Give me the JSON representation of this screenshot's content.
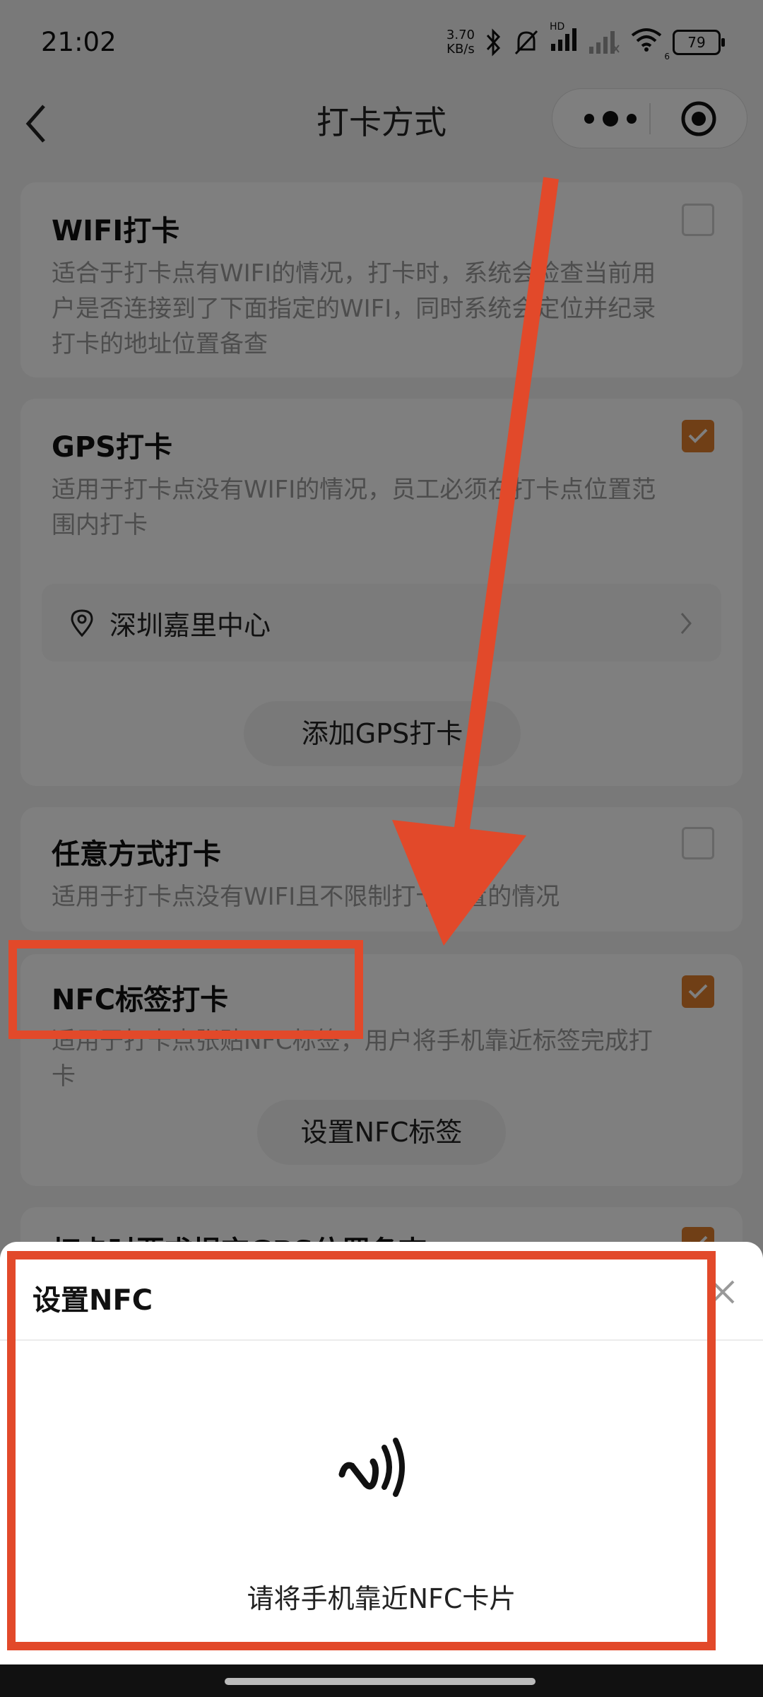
{
  "status_bar": {
    "time": "21:02",
    "net_speed_value": "3.70",
    "net_speed_unit": "KB/s",
    "signal_label": "HD",
    "wifi_label": "6",
    "battery": "79"
  },
  "nav": {
    "title": "打卡方式"
  },
  "cards": {
    "wifi": {
      "title": "WIFI打卡",
      "desc": "适合于打卡点有WIFI的情况，打卡时，系统会检查当前用户是否连接到了下面指定的WIFI，同时系统会定位并纪录打卡的地址位置备查",
      "checked": false
    },
    "gps": {
      "title": "GPS打卡",
      "desc": "适用于打卡点没有WIFI的情况，员工必须在打卡点位置范围内打卡",
      "checked": true,
      "location": "深圳嘉里中心",
      "add_button": "添加GPS打卡"
    },
    "any": {
      "title": "任意方式打卡",
      "desc": "适用于打卡点没有WIFI且不限制打卡位置的情况",
      "checked": false
    },
    "nfc": {
      "title": "NFC标签打卡",
      "desc": "适用于打卡点张贴NFC标签，用户将手机靠近标签完成打卡",
      "checked": true,
      "set_button": "设置NFC标签"
    },
    "next": {
      "title": "打卡时要求提交GPS位置备查",
      "checked": true
    }
  },
  "sheet": {
    "title": "设置NFC",
    "hint": "请将手机靠近NFC卡片"
  },
  "colors": {
    "accent": "#e07f2d",
    "annotation": "#e2492a"
  }
}
